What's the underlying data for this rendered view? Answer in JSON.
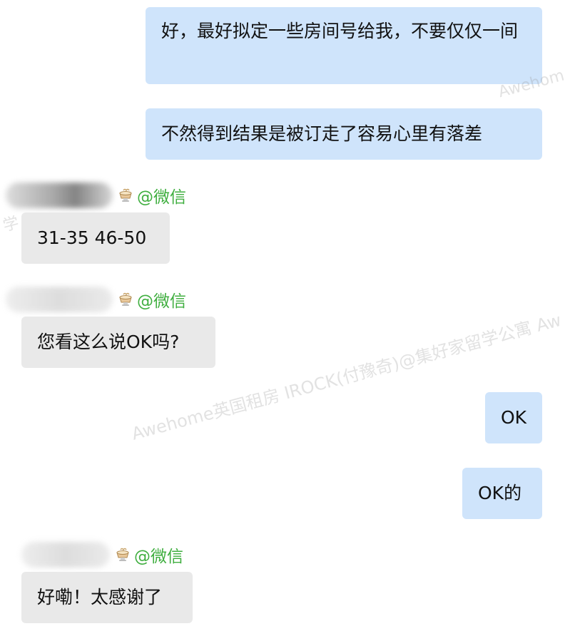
{
  "messages": [
    {
      "id": "m1",
      "direction": "outgoing",
      "text": "好，最好拟定一些房间号给我，不要仅仅一间"
    },
    {
      "id": "m2",
      "direction": "outgoing",
      "text": "不然得到结果是被订走了容易心里有落差"
    },
    {
      "id": "m3",
      "direction": "incoming",
      "sender_handle": "@微信",
      "text": "31-35 46-50"
    },
    {
      "id": "m4",
      "direction": "incoming",
      "sender_handle": "@微信",
      "text": "您看这么说OK吗?"
    },
    {
      "id": "m5",
      "direction": "outgoing",
      "text": "OK"
    },
    {
      "id": "m6",
      "direction": "outgoing",
      "text": "OK的"
    },
    {
      "id": "m7",
      "direction": "incoming",
      "sender_handle": "@微信",
      "text": "好嘞！太感谢了"
    }
  ],
  "watermark": {
    "line_main": "Awehome英国租房 IROCK(付豫奇)@集好家留学公寓 Aw",
    "fragment_top": "Awehom",
    "fragment_left": "学"
  },
  "colors": {
    "outgoing_bubble": "#cfe4fb",
    "incoming_bubble": "#e9e9e9",
    "handle_green": "#3fae3f",
    "text": "#111111"
  },
  "icons": {
    "sender_badge": "cup-icon"
  }
}
